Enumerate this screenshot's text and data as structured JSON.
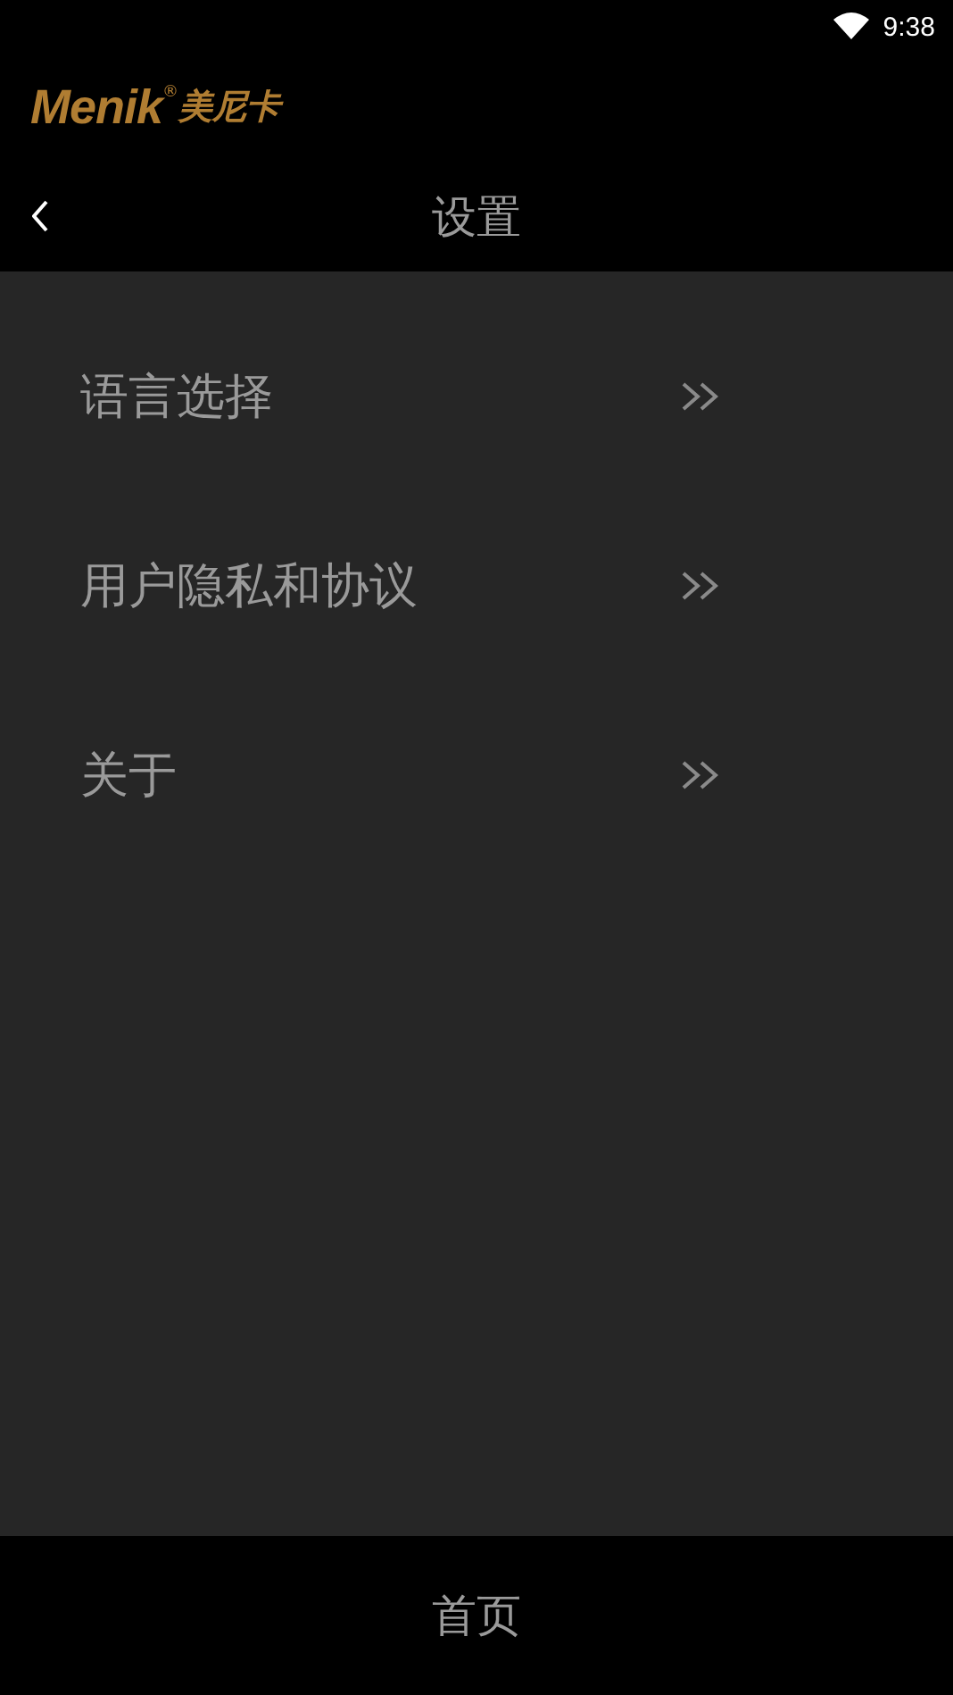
{
  "status_bar": {
    "time": "9:38"
  },
  "logo": {
    "name": "Menik",
    "mark": "®",
    "name_cn": "美尼卡"
  },
  "nav_bar": {
    "title": "设置"
  },
  "menu": [
    {
      "label": "语言选择"
    },
    {
      "label": "用户隐私和协议"
    },
    {
      "label": "关于"
    }
  ],
  "bottom_bar": {
    "label": "首页"
  }
}
